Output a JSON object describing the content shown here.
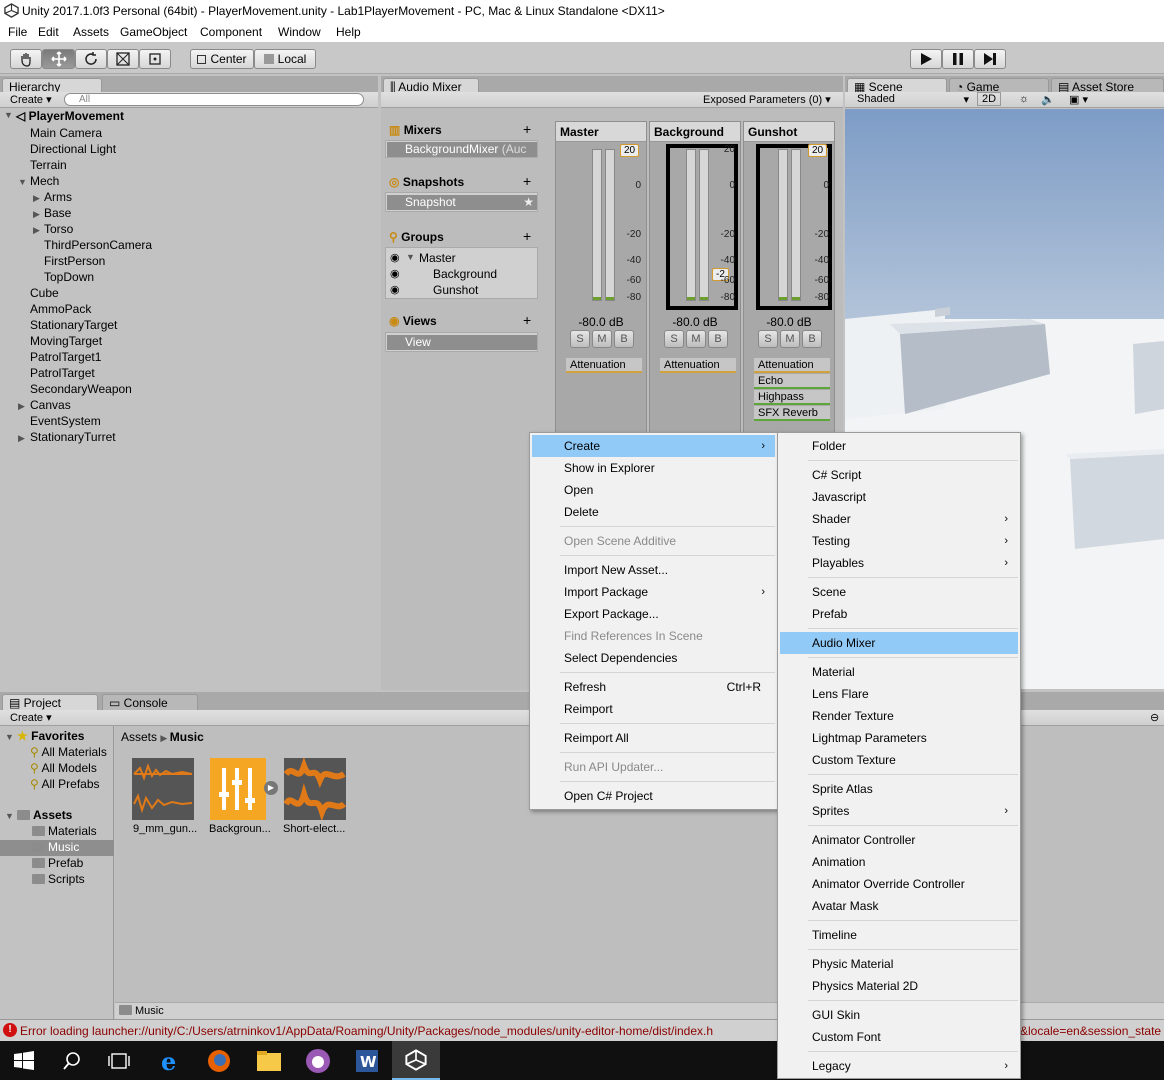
{
  "window": {
    "title": "Unity 2017.1.0f3 Personal (64bit) - PlayerMovement.unity - Lab1PlayerMovement - PC, Mac & Linux Standalone <DX11>"
  },
  "menubar": [
    "File",
    "Edit",
    "Assets",
    "GameObject",
    "Component",
    "Window",
    "Help"
  ],
  "toolbar": {
    "pivot": "Center",
    "space": "Local"
  },
  "hierarchy": {
    "tab": "Hierarchy",
    "create": "Create",
    "search_placeholder": "All",
    "scene": "PlayerMovement",
    "items": [
      "Main Camera",
      "Directional Light",
      "Terrain",
      "Mech",
      "Arms",
      "Base",
      "Torso",
      "ThirdPersonCamera",
      "FirstPerson",
      "TopDown",
      "Cube",
      "AmmoPack",
      "StationaryTarget",
      "MovingTarget",
      "PatrolTarget1",
      "PatrolTarget",
      "SecondaryWeapon",
      "Canvas",
      "EventSystem",
      "StationaryTurret"
    ]
  },
  "audio_mixer": {
    "tab": "Audio Mixer",
    "exposed": "Exposed Parameters (0)",
    "mixers_title": "Mixers",
    "mixer_item": "BackgroundMixer",
    "mixer_item_suffix": "(Auc",
    "snapshots_title": "Snapshots",
    "snapshot_item": "Snapshot",
    "groups_title": "Groups",
    "groups": [
      "Master",
      "Background",
      "Gunshot"
    ],
    "views_title": "Views",
    "view_item": "View",
    "scale": [
      "20",
      "0",
      "-20",
      "-40",
      "-60",
      "-80"
    ],
    "strips": [
      {
        "name": "Master",
        "db": "-80.0 dB",
        "fader": "20",
        "effects": [
          "Attenuation"
        ]
      },
      {
        "name": "Background",
        "db": "-80.0 dB",
        "fader": "-2",
        "effects": [
          "Attenuation"
        ]
      },
      {
        "name": "Gunshot",
        "db": "-80.0 dB",
        "fader": "20",
        "effects": [
          "Attenuation",
          "Echo",
          "Highpass",
          "SFX Reverb"
        ]
      }
    ],
    "smb": [
      "S",
      "M",
      "B"
    ]
  },
  "scene": {
    "tabs": [
      "Scene",
      "Game",
      "Asset Store"
    ],
    "shading": "Shaded",
    "mode2d": "2D"
  },
  "project": {
    "tabs": [
      "Project",
      "Console"
    ],
    "create": "Create",
    "favorites_title": "Favorites",
    "favorites": [
      "All Materials",
      "All Models",
      "All Prefabs"
    ],
    "assets_title": "Assets",
    "folders": [
      "Materials",
      "Music",
      "Prefab",
      "Scripts"
    ],
    "breadcrumb": [
      "Assets",
      "Music"
    ],
    "assets": [
      "9_mm_gun...",
      "Backgroun...",
      "Short-elect..."
    ],
    "footer_path": "Music"
  },
  "status": {
    "error": "Error loading launcher://unity/C:/Users/atrninkov1/AppData/Roaming/Unity/Packages/node_modules/unity-editor-home/dist/index.h",
    "error_tail": "&locale=en&session_state"
  },
  "context_menu": {
    "items": [
      {
        "label": "Create",
        "submenu": true,
        "highlight": true
      },
      {
        "label": "Show in Explorer"
      },
      {
        "label": "Open"
      },
      {
        "label": "Delete"
      },
      {
        "sep": true
      },
      {
        "label": "Open Scene Additive",
        "disabled": true
      },
      {
        "sep": true
      },
      {
        "label": "Import New Asset..."
      },
      {
        "label": "Import Package",
        "submenu": true
      },
      {
        "label": "Export Package..."
      },
      {
        "label": "Find References In Scene",
        "disabled": true
      },
      {
        "label": "Select Dependencies"
      },
      {
        "sep": true
      },
      {
        "label": "Refresh",
        "shortcut": "Ctrl+R"
      },
      {
        "label": "Reimport"
      },
      {
        "sep": true
      },
      {
        "label": "Reimport All"
      },
      {
        "sep": true
      },
      {
        "label": "Run API Updater...",
        "disabled": true
      },
      {
        "sep": true
      },
      {
        "label": "Open C# Project"
      }
    ]
  },
  "create_submenu": {
    "items": [
      {
        "label": "Folder"
      },
      {
        "sep": true
      },
      {
        "label": "C# Script"
      },
      {
        "label": "Javascript"
      },
      {
        "label": "Shader",
        "submenu": true
      },
      {
        "label": "Testing",
        "submenu": true
      },
      {
        "label": "Playables",
        "submenu": true
      },
      {
        "sep": true
      },
      {
        "label": "Scene"
      },
      {
        "label": "Prefab"
      },
      {
        "sep": true
      },
      {
        "label": "Audio Mixer",
        "highlight": true
      },
      {
        "sep": true
      },
      {
        "label": "Material"
      },
      {
        "label": "Lens Flare"
      },
      {
        "label": "Render Texture"
      },
      {
        "label": "Lightmap Parameters"
      },
      {
        "label": "Custom Texture"
      },
      {
        "sep": true
      },
      {
        "label": "Sprite Atlas"
      },
      {
        "label": "Sprites",
        "submenu": true
      },
      {
        "sep": true
      },
      {
        "label": "Animator Controller"
      },
      {
        "label": "Animation"
      },
      {
        "label": "Animator Override Controller"
      },
      {
        "label": "Avatar Mask"
      },
      {
        "sep": true
      },
      {
        "label": "Timeline"
      },
      {
        "sep": true
      },
      {
        "label": "Physic Material"
      },
      {
        "label": "Physics Material 2D"
      },
      {
        "sep": true
      },
      {
        "label": "GUI Skin"
      },
      {
        "label": "Custom Font"
      },
      {
        "sep": true
      },
      {
        "label": "Legacy",
        "submenu": true
      }
    ]
  },
  "icons": {
    "toolbar": [
      "hand-icon",
      "move-icon",
      "rotate-icon",
      "scale-icon",
      "rect-icon"
    ],
    "play": [
      "play-icon",
      "pause-icon",
      "step-icon"
    ],
    "taskbar": [
      "windows-start-icon",
      "search-icon",
      "task-view-icon",
      "ie-icon",
      "firefox-icon",
      "file-explorer-icon",
      "cat-icon",
      "word-icon",
      "unity-icon"
    ]
  },
  "colors": {
    "accent": "#91c9f7",
    "fader": "#d39a2c",
    "effect_green": "#5fa63a",
    "error": "#8b0000"
  }
}
